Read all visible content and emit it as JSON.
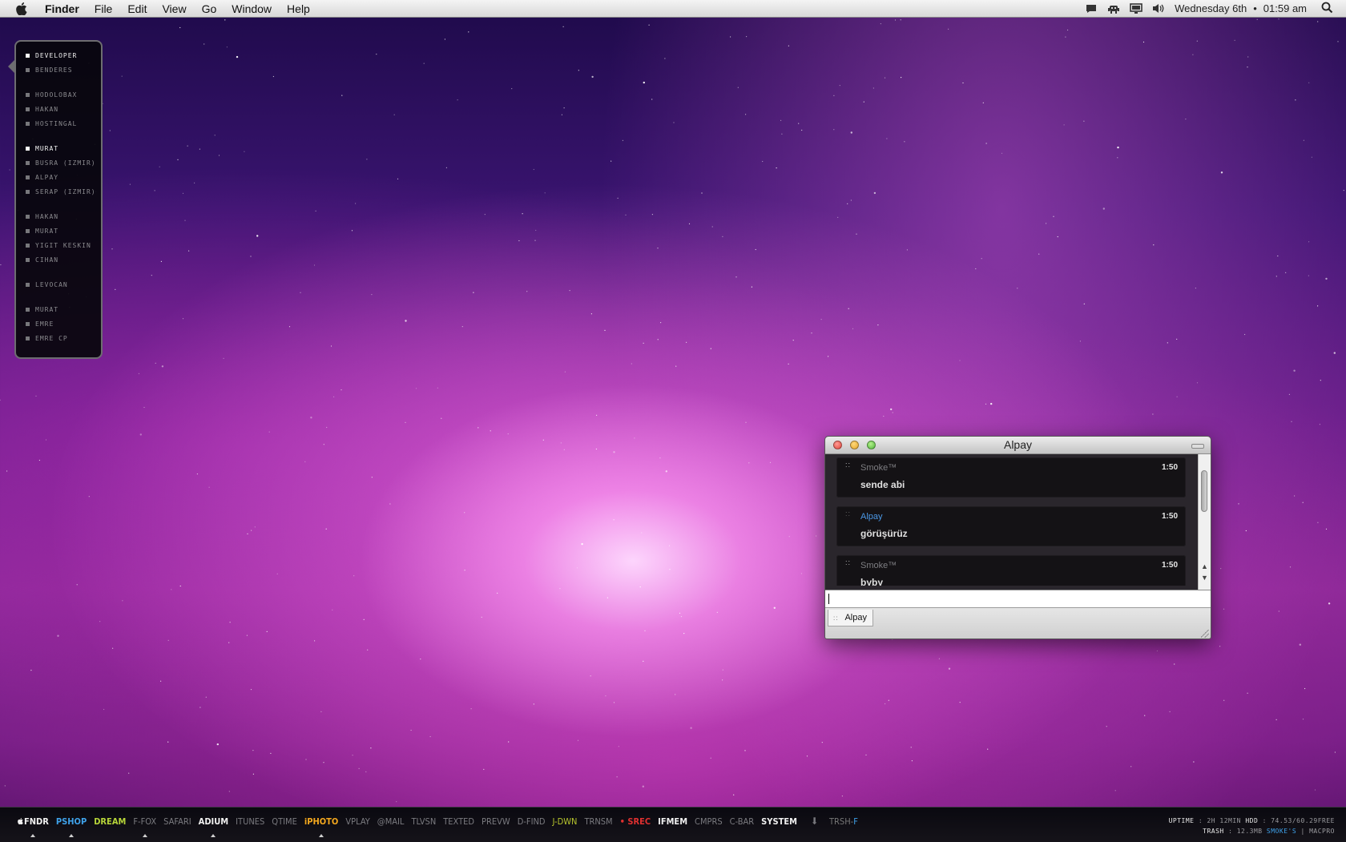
{
  "menubar": {
    "app_name": "Finder",
    "menus": [
      "File",
      "Edit",
      "View",
      "Go",
      "Window",
      "Help"
    ],
    "date": "Wednesday 6th",
    "separator": "•",
    "time": "01:59 am"
  },
  "contacts_panel": {
    "items": [
      {
        "label": "DEVELOPER",
        "active": true
      },
      {
        "label": "BENDERES",
        "active": false
      },
      {
        "label": "HODOLOBAX",
        "active": false
      },
      {
        "label": "HAKAN",
        "active": false
      },
      {
        "label": "HOSTINGAL",
        "active": false
      },
      {
        "label": "MURAT",
        "active": true
      },
      {
        "label": "BUSRA (IZMIR)",
        "active": false
      },
      {
        "label": "ALPAY",
        "active": false
      },
      {
        "label": "SERAP (IZMIR)",
        "active": false
      },
      {
        "label": "HAKAN",
        "active": false
      },
      {
        "label": "MURAT",
        "active": false
      },
      {
        "label": "YIGIT KESKIN",
        "active": false
      },
      {
        "label": "CIHAN",
        "active": false
      },
      {
        "label": "LEVOCAN",
        "active": false
      },
      {
        "label": "MURAT",
        "active": false
      },
      {
        "label": "EMRE",
        "active": false
      },
      {
        "label": "EMRE CP",
        "active": false
      }
    ]
  },
  "chat_window": {
    "title": "Alpay",
    "messages": [
      {
        "sender": "Smoke™",
        "time": "1:50",
        "text": "sende abi",
        "self": true
      },
      {
        "sender": "Alpay",
        "time": "1:50",
        "text": "görüşürüz",
        "self": false
      },
      {
        "sender": "Smoke™",
        "time": "1:50",
        "text": "byby",
        "self": true
      }
    ],
    "input_value": "",
    "tab_label": "Alpay"
  },
  "launcher": {
    "apps": [
      {
        "label": "FNDR",
        "style": "hl",
        "running": true,
        "apple": true
      },
      {
        "label": "PSHOP",
        "style": "blue",
        "running": true
      },
      {
        "label": "DREAM",
        "style": "green",
        "running": false
      },
      {
        "label": "F-FOX",
        "style": "",
        "running": true
      },
      {
        "label": "SAFARI",
        "style": "",
        "running": false
      },
      {
        "label": "ADIUM",
        "style": "hl",
        "running": true
      },
      {
        "label": "ITUNES",
        "style": "",
        "running": false
      },
      {
        "label": "QTIME",
        "style": "",
        "running": false
      },
      {
        "label": "iPHOTO",
        "style": "orange",
        "running": true
      },
      {
        "label": "VPLAY",
        "style": "",
        "running": false
      },
      {
        "label": "@MAIL",
        "style": "",
        "running": false
      },
      {
        "label": "TLVSN",
        "style": "",
        "running": false
      },
      {
        "label": "TEXTED",
        "style": "",
        "running": false
      },
      {
        "label": "PREVW",
        "style": "",
        "running": false
      },
      {
        "label": "D-FIND",
        "style": "",
        "running": false
      },
      {
        "label": "J-DWN",
        "style": "ygreen",
        "running": false
      },
      {
        "label": "TRNSM",
        "style": "",
        "running": false
      },
      {
        "label": "• SREC",
        "style": "red",
        "running": false
      },
      {
        "label": "IFMEM",
        "style": "hl",
        "running": false
      },
      {
        "label": "CMPRS",
        "style": "",
        "running": false
      },
      {
        "label": "C-BAR",
        "style": "",
        "running": false
      },
      {
        "label": "SYSTEM",
        "style": "hl",
        "running": false
      }
    ],
    "download_icon": "download-arrow-icon",
    "trash_label": "TRSH-",
    "trash_suffix": "F",
    "stats_line1_label1": "UPTIME",
    "stats_line1_value1": ": 2H 12MIN",
    "stats_line1_label2": "HDD",
    "stats_line1_value2": ": 74.53/60.29FREE",
    "stats_line2_label": "TRASH",
    "stats_line2_value": ": 12.3MB",
    "stats_line2_owner": "SMOKE'S",
    "stats_line2_machine": "| MACPRO"
  },
  "colors": {
    "accent_blue": "#3fa2ea",
    "sender_blue": "#4b98e6",
    "record_red": "#e03030",
    "iphoto_orange": "#f4a81e",
    "dream_green": "#b6d439"
  }
}
